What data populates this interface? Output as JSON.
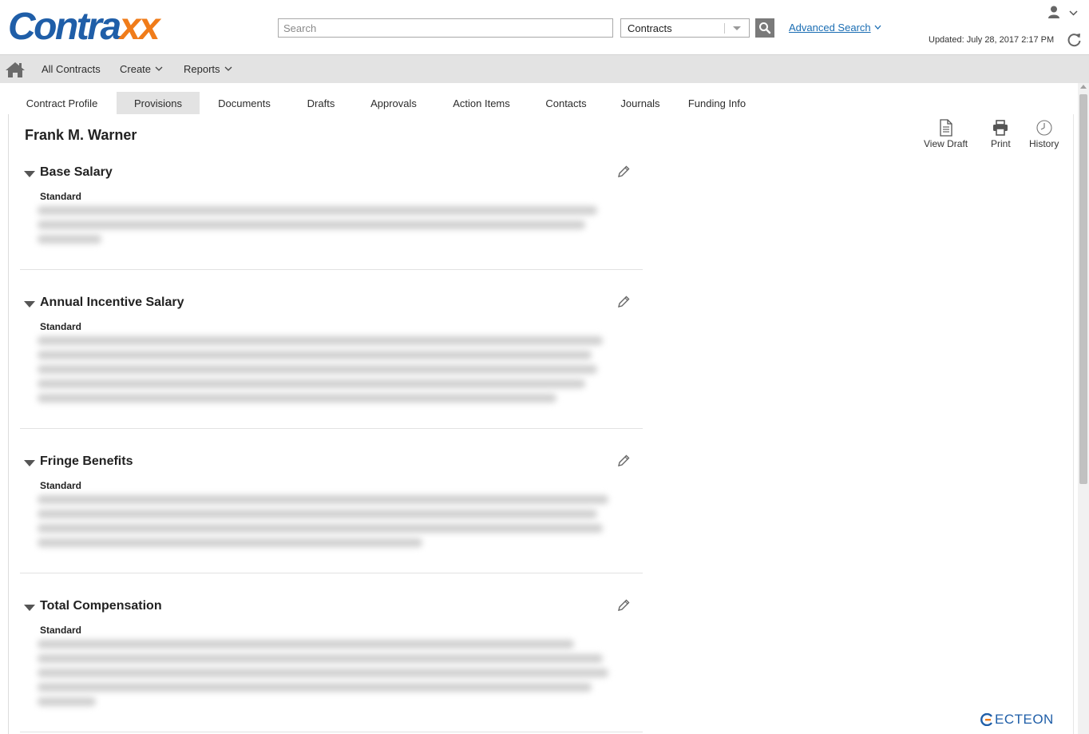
{
  "header": {
    "logo_main": "Contra",
    "logo_accent": "xx",
    "search_placeholder": "Search",
    "scope_value": "Contracts",
    "advanced_search_label": "Advanced Search",
    "updated_text": "Updated:  July 28, 2017   2:17 PM"
  },
  "nav": {
    "items": [
      {
        "label": "All Contracts"
      },
      {
        "label": "Create"
      },
      {
        "label": "Reports"
      }
    ]
  },
  "tabs": [
    {
      "label": "Contract Profile"
    },
    {
      "label": "Provisions",
      "active": true
    },
    {
      "label": "Documents"
    },
    {
      "label": "Drafts"
    },
    {
      "label": "Approvals"
    },
    {
      "label": "Action Items"
    },
    {
      "label": "Contacts"
    },
    {
      "label": "Journals"
    },
    {
      "label": "Funding Info"
    }
  ],
  "content": {
    "person_name": "Frank M. Warner",
    "actions": [
      {
        "label": "View Draft",
        "icon": "document-icon"
      },
      {
        "label": "Print",
        "icon": "printer-icon"
      },
      {
        "label": "History",
        "icon": "clock-icon"
      }
    ],
    "sections": [
      {
        "title": "Base Salary",
        "subtitle": "Standard"
      },
      {
        "title": "Annual Incentive Salary",
        "subtitle": "Standard"
      },
      {
        "title": "Fringe Benefits",
        "subtitle": "Standard"
      },
      {
        "title": "Total Compensation",
        "subtitle": "Standard"
      }
    ]
  },
  "footer": {
    "brand": "ECTEON"
  },
  "colors": {
    "brand_blue": "#1f5ea8",
    "brand_orange": "#f07c1a",
    "link_blue": "#1a6db3",
    "nav_bg": "#e3e3e3"
  }
}
